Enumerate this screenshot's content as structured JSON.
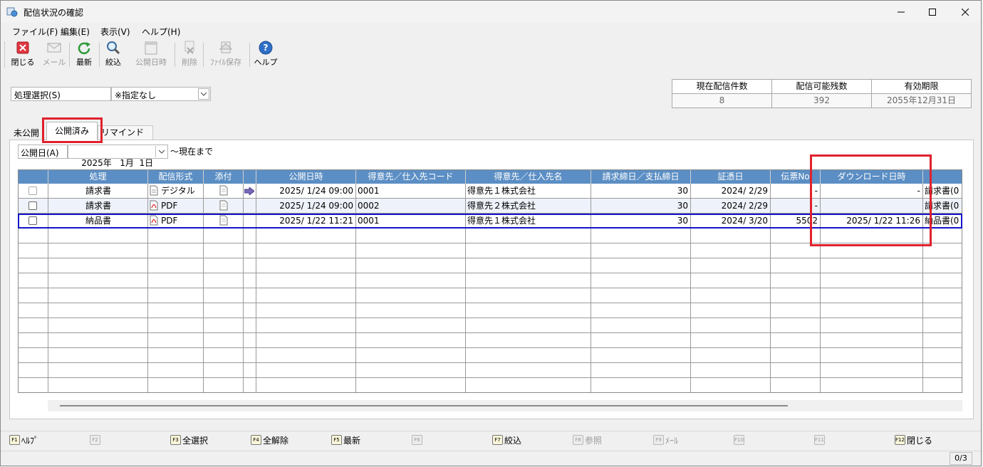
{
  "window": {
    "title": "配信状況の確認"
  },
  "menu": [
    "ファイル(F)",
    "編集(E)",
    "表示(V)",
    "ヘルプ(H)"
  ],
  "toolbar": {
    "close": "閉じる",
    "mail": "メール",
    "refresh": "最新",
    "filter": "絞込",
    "publish_datetime": "公開日時",
    "delete": "削除",
    "file_save": "ﾌｧｲﾙ保存",
    "help": "ヘルプ"
  },
  "process": {
    "label": "処理選択(S)",
    "value": "※指定なし"
  },
  "stats": [
    {
      "label": "現在配信件数",
      "value": "8"
    },
    {
      "label": "配信可能残数",
      "value": "392"
    },
    {
      "label": "有効期限",
      "value": "2055年12月31日"
    }
  ],
  "tabs": {
    "unpublished": "未公開",
    "published": "公開済み",
    "remind": "リマインド"
  },
  "date_filter": {
    "label": "公開日(A)",
    "value": "2025年   1月  1日",
    "suffix": "～現在まで"
  },
  "grid": {
    "headers": [
      "",
      "処理",
      "配信形式",
      "添付",
      "",
      "公開日時",
      "得意先／仕入先コード",
      "得意先／仕入先名",
      "請求締日／支払締日",
      "証憑日",
      "伝票No",
      "ダウンロード日時",
      ""
    ],
    "rows": [
      {
        "process": "請求書",
        "format": "デジタル",
        "publish": "2025/ 1/24 09:00",
        "code": "0001",
        "name": "得意先１株式会社",
        "closing": "30",
        "voucher_date": "2024/ 2/29",
        "slip": "-",
        "download": "-",
        "extra": "請求書(0"
      },
      {
        "process": "請求書",
        "format": "PDF",
        "publish": "2025/ 1/24 09:00",
        "code": "0002",
        "name": "得意先２株式会社",
        "closing": "30",
        "voucher_date": "2024/ 2/29",
        "slip": "-",
        "download": "",
        "extra": "請求書(0"
      },
      {
        "process": "納品書",
        "format": "PDF",
        "publish": "2025/ 1/22 11:21",
        "code": "0001",
        "name": "得意先１株式会社",
        "closing": "30",
        "voucher_date": "2024/ 3/20",
        "slip": "5502",
        "download": "2025/ 1/22 11:26",
        "extra": "納品書(0"
      }
    ]
  },
  "fkeys": [
    {
      "key": "F1",
      "label": "ﾍﾙﾌﾟ"
    },
    {
      "key": "F2",
      "label": ""
    },
    {
      "key": "F3",
      "label": "全選択"
    },
    {
      "key": "F4",
      "label": "全解除"
    },
    {
      "key": "F5",
      "label": "最新"
    },
    {
      "key": "F6",
      "label": ""
    },
    {
      "key": "F7",
      "label": "絞込"
    },
    {
      "key": "F8",
      "label": "参照"
    },
    {
      "key": "F9",
      "label": "ﾒｰﾙ"
    },
    {
      "key": "F10",
      "label": ""
    },
    {
      "key": "F11",
      "label": ""
    },
    {
      "key": "F12",
      "label": "閉じる"
    }
  ],
  "status": {
    "count": "0/3"
  }
}
